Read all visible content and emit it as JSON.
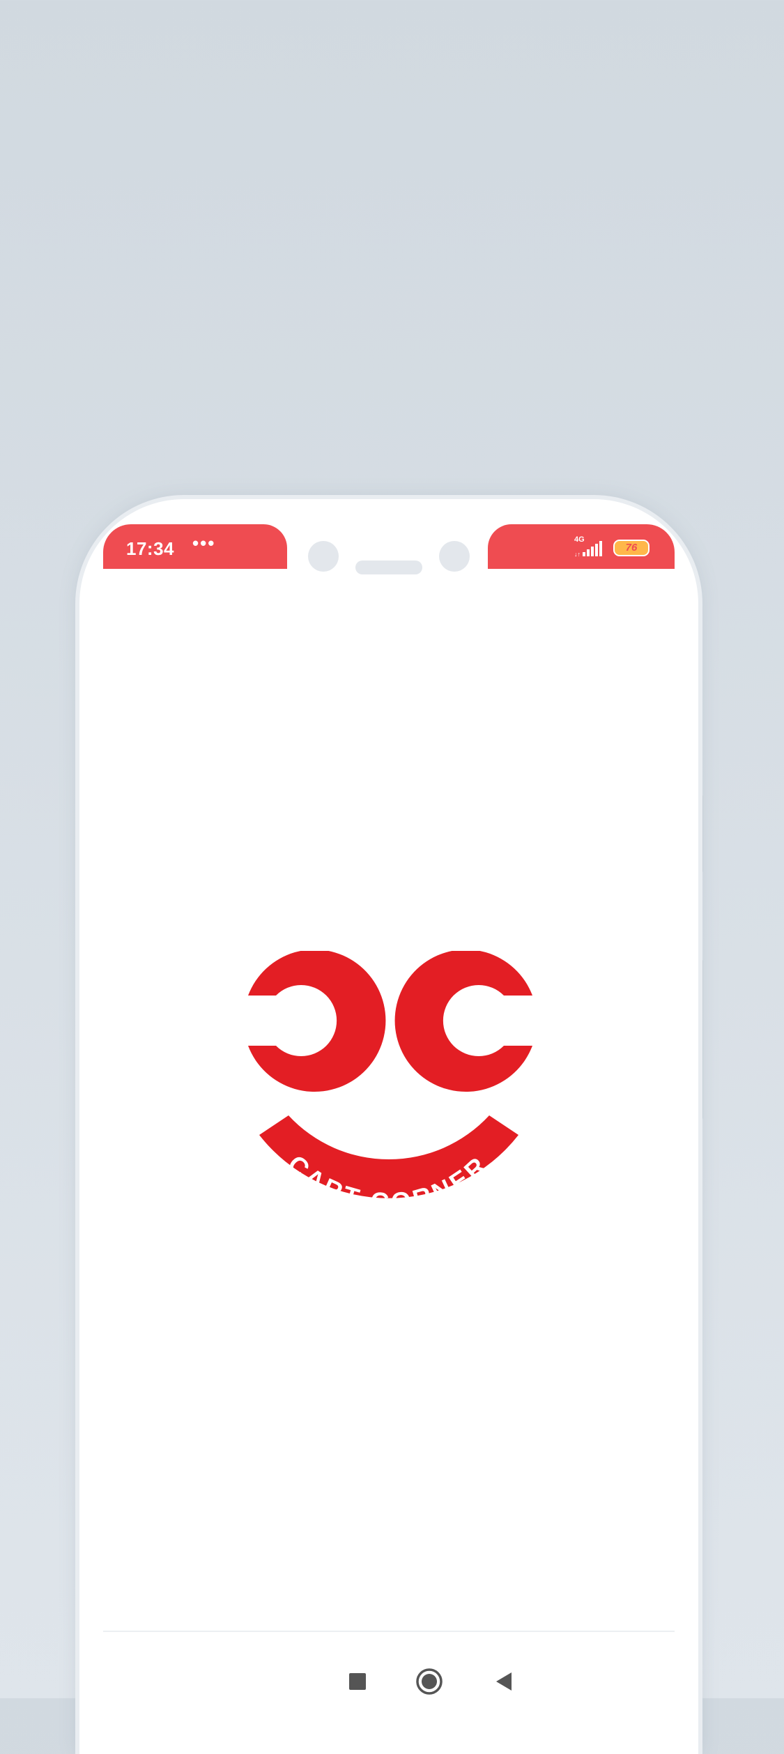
{
  "status_bar": {
    "time": "17:34",
    "more_indicator": "•••",
    "network_label": "4G",
    "battery_level": "76",
    "icons": [
      "signal-icon",
      "battery-icon"
    ]
  },
  "logo": {
    "brand_text": "CART CORNER",
    "monogram": "CC",
    "color": "#e31e24"
  },
  "nav_bar": {
    "icons": [
      "recents-square-icon",
      "home-circle-icon",
      "back-triangle-icon"
    ]
  },
  "colors": {
    "status_bar_accent": "#ef4c51",
    "brand_red": "#e31e24",
    "background": "#d1d9e0"
  }
}
